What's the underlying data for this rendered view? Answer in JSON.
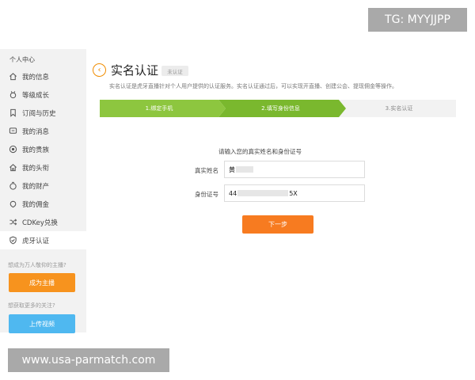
{
  "sidebar": {
    "title": "个人中心",
    "items": [
      {
        "label": "我的信息",
        "icon": "home-icon"
      },
      {
        "label": "等级成长",
        "icon": "medal-icon"
      },
      {
        "label": "订阅与历史",
        "icon": "bookmark-icon"
      },
      {
        "label": "我的消息",
        "icon": "message-icon"
      },
      {
        "label": "我的贵族",
        "icon": "noble-icon"
      },
      {
        "label": "我的头衔",
        "icon": "title-icon"
      },
      {
        "label": "我的财产",
        "icon": "wallet-icon"
      },
      {
        "label": "我的佣金",
        "icon": "commission-icon"
      },
      {
        "label": "CDKey兑换",
        "icon": "shuffle-icon"
      },
      {
        "label": "虎牙认证",
        "icon": "shield-check-icon"
      }
    ],
    "anchor_prompt": "想成为万人敬仰的主播?",
    "anchor_button": "成为主播",
    "video_prompt": "想获取更多的关注?",
    "video_button": "上传视频"
  },
  "header": {
    "title": "实名认证",
    "status": "未认证",
    "description": "实名认证是虎牙直播针对个人用户提供的认证服务。实名认证通过后，可以实现开直播、创建公会、提现佣金等操作。"
  },
  "steps": [
    {
      "label": "1.绑定手机",
      "state": "done"
    },
    {
      "label": "2.填写身份信息",
      "state": "current"
    },
    {
      "label": "3.实名认证",
      "state": "pending"
    }
  ],
  "form": {
    "heading": "请输入您的真实姓名和身份证号",
    "name_label": "真实姓名",
    "name_value": "黄",
    "id_label": "身份证号",
    "id_prefix": "44",
    "id_suffix": "5X",
    "next_button": "下一步"
  },
  "watermarks": {
    "top_right": "TG: MYYJJPP",
    "bottom_left": "www.usa-parmatch.com"
  },
  "colors": {
    "accent_orange": "#f77b20",
    "step_green": "#8dc63f",
    "step_green_dark": "#7ab82e",
    "step_gray": "#f2f2f2",
    "upload_blue": "#4fb8f0"
  }
}
